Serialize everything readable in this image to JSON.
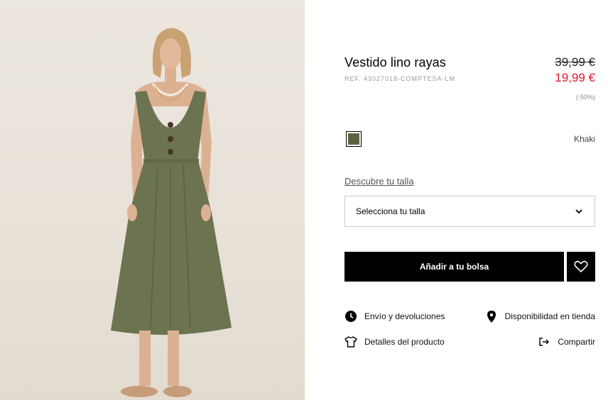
{
  "product": {
    "title": "Vestido lino rayas",
    "ref": "REF. 43027018-COMPTESA-LM",
    "old_price": "39,99 €",
    "new_price": "19,99 €",
    "discount": "(-50%)",
    "color_name": "Khaki",
    "swatch_color": "#5b6440"
  },
  "size": {
    "link_label": "Descubre tu talla",
    "select_label": "Selecciona tu talla"
  },
  "actions": {
    "add_to_bag": "Añadir a tu bolsa"
  },
  "links": {
    "shipping": "Envío y devoluciones",
    "store": "Disponibilidad en tienda",
    "details": "Detalles del producto",
    "share": "Compartir"
  },
  "colors": {
    "sale_red": "#e4172b",
    "dress_khaki": "#6b7350"
  }
}
